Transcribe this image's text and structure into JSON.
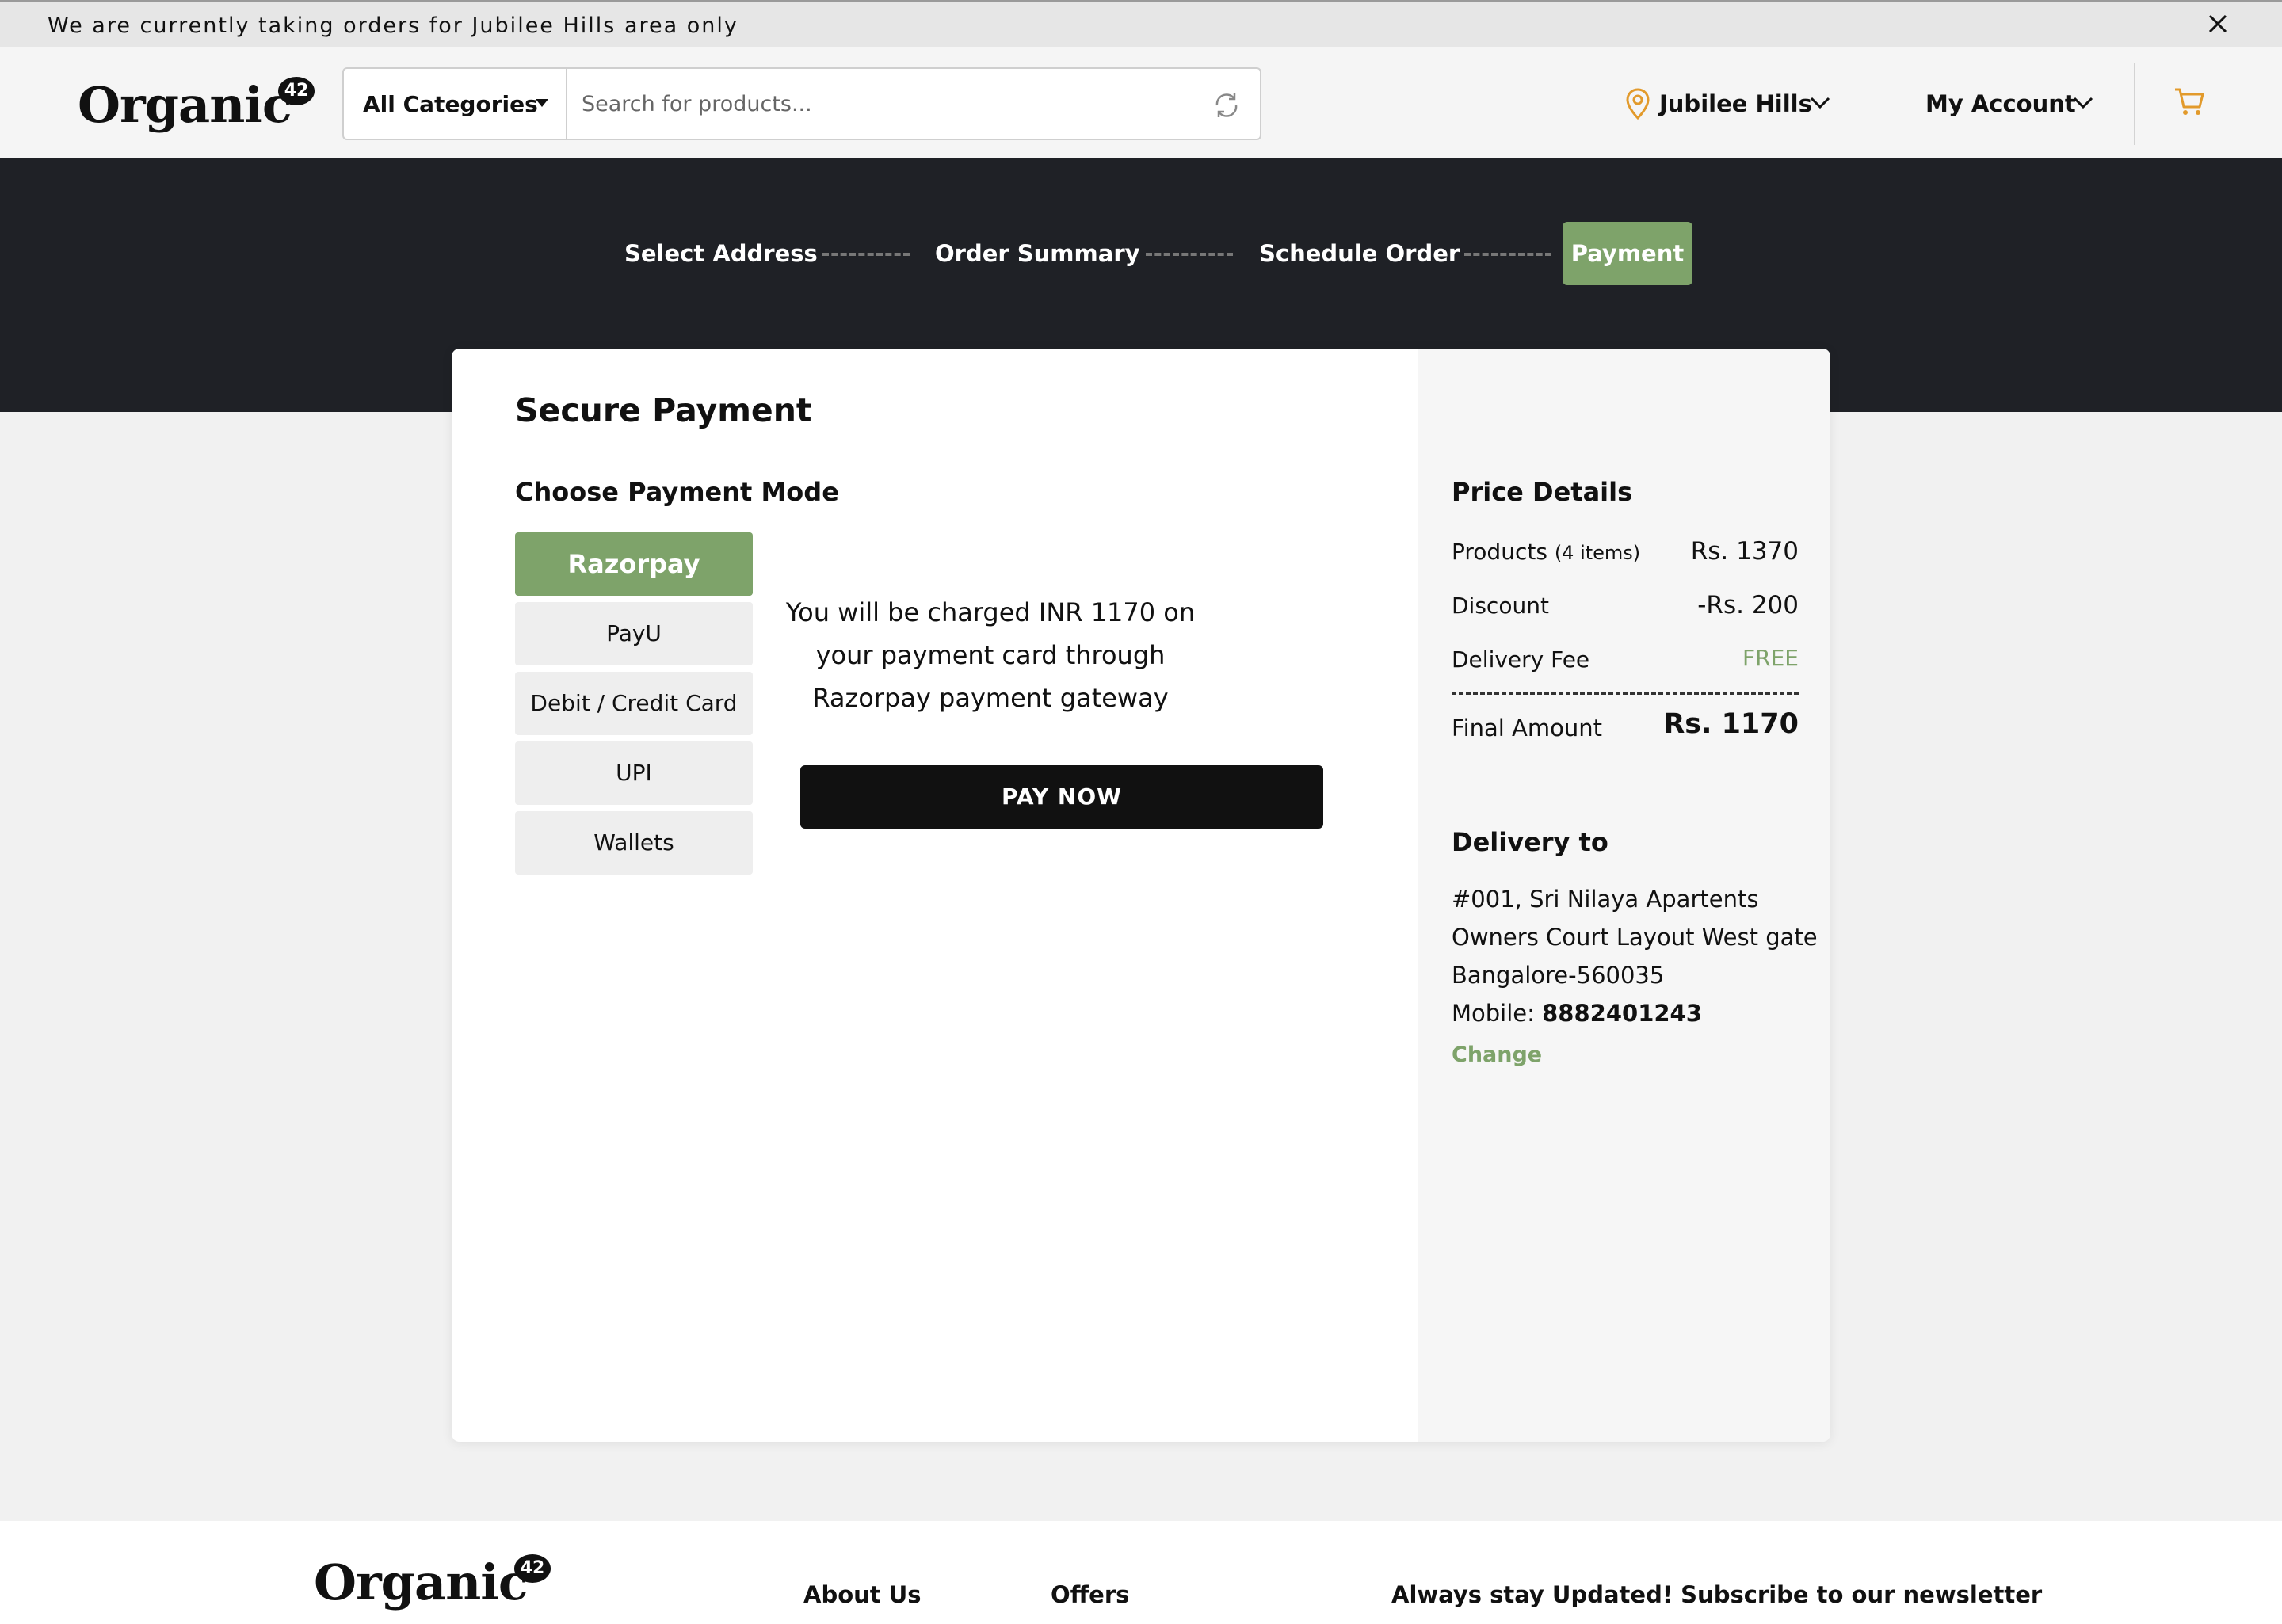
{
  "announcement": {
    "text": "We are currently taking orders for Jubilee Hills area only"
  },
  "header": {
    "logo_text": "Organic",
    "logo_badge": "42",
    "category_label": "All Categories",
    "search_placeholder": "Search for products...",
    "location_label": "Jubilee Hills",
    "account_label": "My Account"
  },
  "steps": {
    "items": [
      "Select Address",
      "Order Summary",
      "Schedule Order"
    ],
    "active": "Payment"
  },
  "payment": {
    "title": "Secure Payment",
    "choose_title": "Choose Payment Mode",
    "modes": [
      "Razorpay",
      "PayU",
      "Debit / Credit Card",
      "UPI",
      "Wallets"
    ],
    "selected_mode": "Razorpay",
    "charge_text": "You will be charged INR 1170 on your payment card through Razorpay payment gateway",
    "pay_button": "PAY NOW"
  },
  "price_details": {
    "title": "Price Details",
    "products_label": "Products",
    "products_count": "(4 items)",
    "products_value": "Rs. 1370",
    "discount_label": "Discount",
    "discount_value": "-Rs. 200",
    "delivery_label": "Delivery Fee",
    "delivery_value": "FREE",
    "final_label": "Final Amount",
    "final_value": "Rs. 1170"
  },
  "delivery": {
    "title": "Delivery to",
    "line1": "#001, Sri Nilaya Apartents",
    "line2": "Owners Court Layout West gate",
    "line3": "Bangalore-560035",
    "mobile_label": "Mobile:",
    "mobile_value": "8882401243",
    "change_label": "Change"
  },
  "footer": {
    "about": "About Us",
    "offers": "Offers",
    "newsletter": "Always stay Updated! Subscribe to our newsletter"
  },
  "colors": {
    "accent_green": "#7ea36a",
    "dark_band": "#1f2126",
    "pin_orange": "#e29a2b"
  }
}
